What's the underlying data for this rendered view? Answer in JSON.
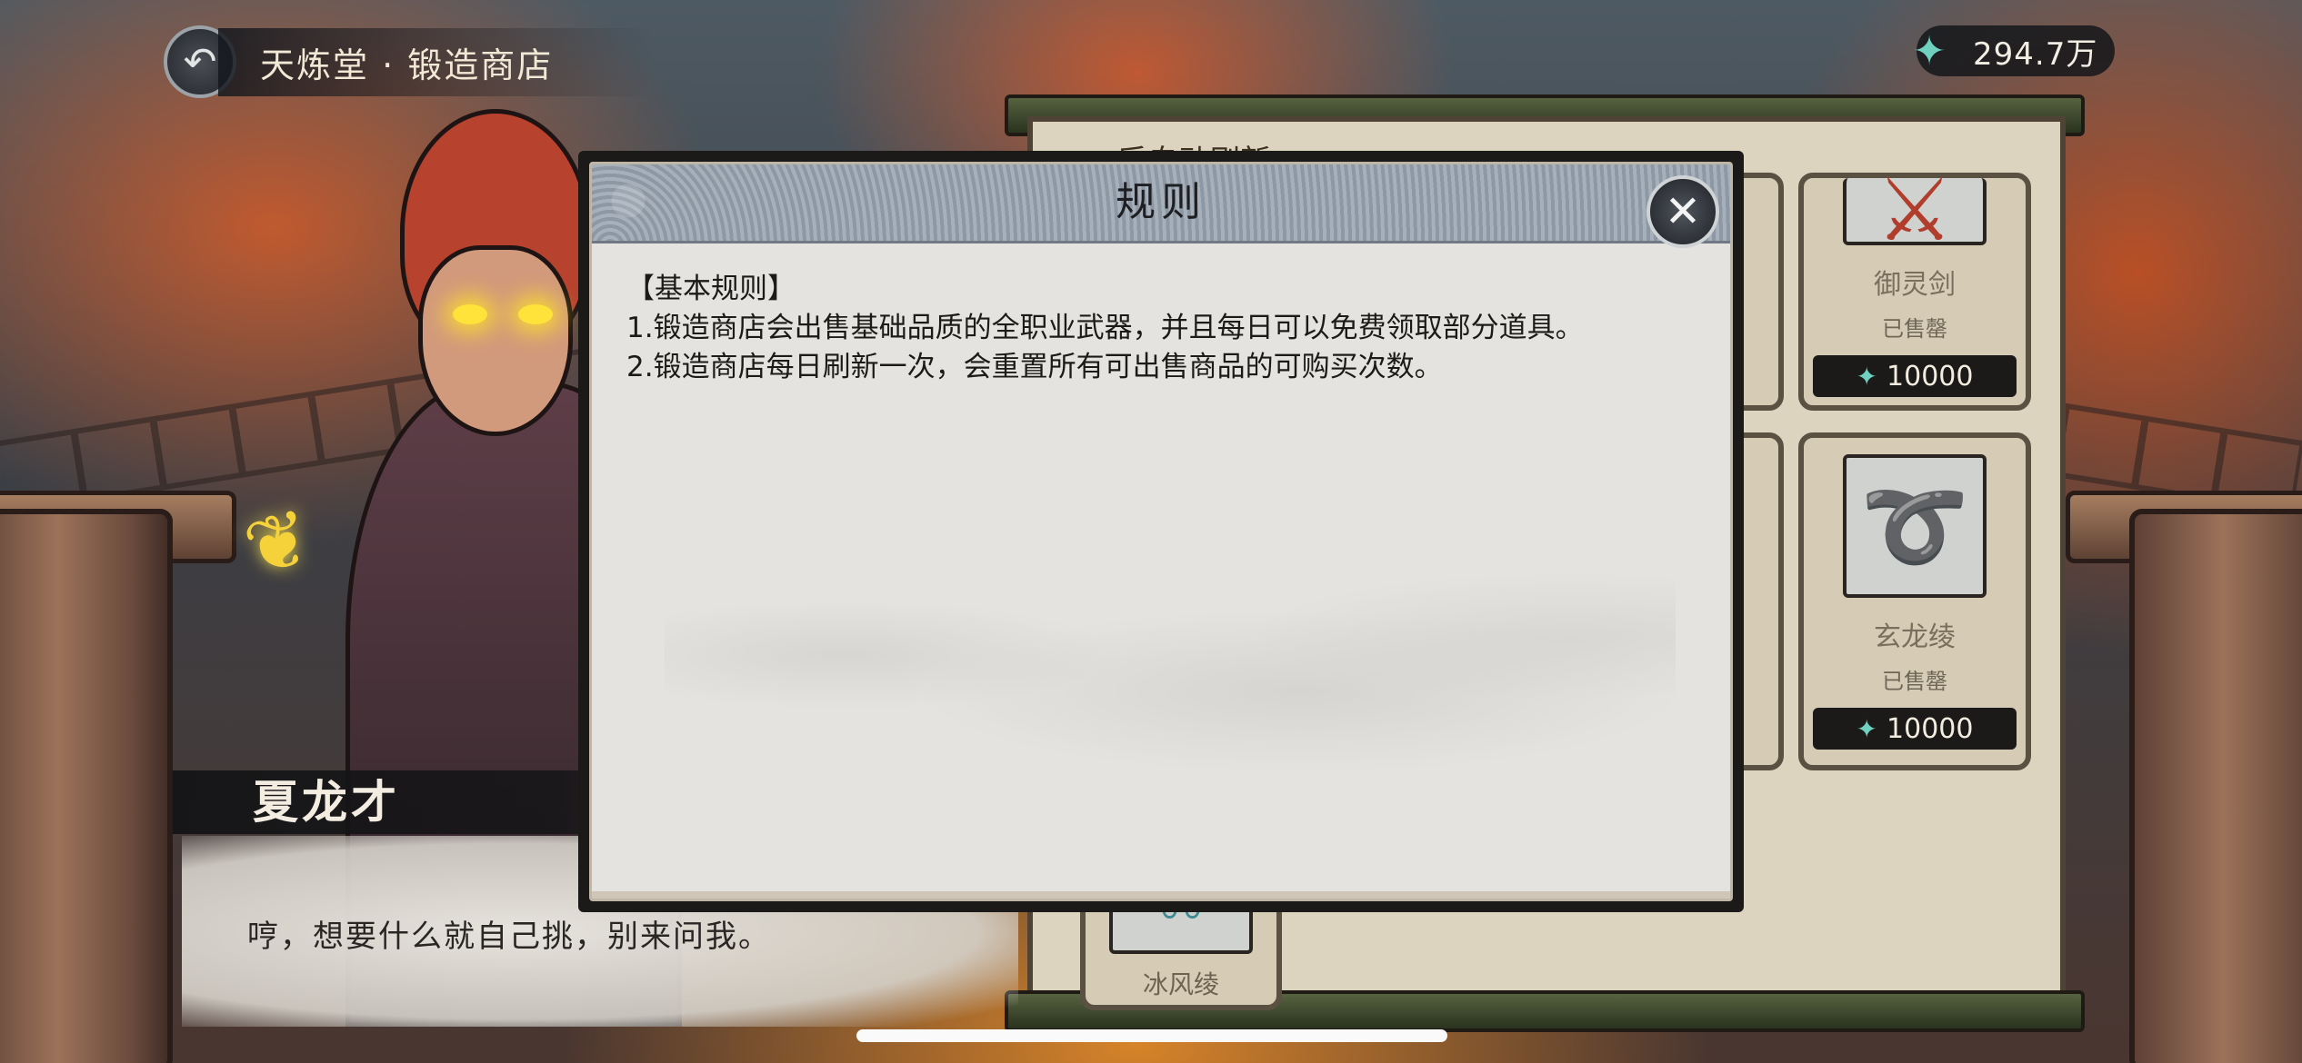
{
  "header": {
    "title": "天炼堂 · 锻造商店",
    "back_icon": "back-arrow-icon"
  },
  "currency": {
    "icon": "jade-gem-plus-icon",
    "value": "294.7万"
  },
  "shop": {
    "refresh_text": "……后自动刷新",
    "items": [
      {
        "name": "御灵剑",
        "status": "已售罄",
        "price": "10000",
        "icon": "sword-icon"
      },
      {
        "name": "玄龙绫",
        "status": "已售罄",
        "price": "10000",
        "icon": "ribbon-icon"
      },
      {
        "name": "冰风绫",
        "icon": "ribbon-icon"
      }
    ]
  },
  "speaker": {
    "name": "夏龙才",
    "line": "哼，想要什么就自己挑，别来问我。"
  },
  "modal": {
    "title": "规则",
    "close_icon": "close-icon",
    "rules": [
      "【基本规则】",
      "1.锻造商店会出售基础品质的全职业武器，并且每日可以免费领取部分道具。",
      "2.锻造商店每日刷新一次，会重置所有可出售商品的可购买次数。"
    ]
  },
  "colors": {
    "currency_gem": "#6fd2c0",
    "modal_bg": "#e5e3df",
    "modal_header": "#98a2ad"
  }
}
